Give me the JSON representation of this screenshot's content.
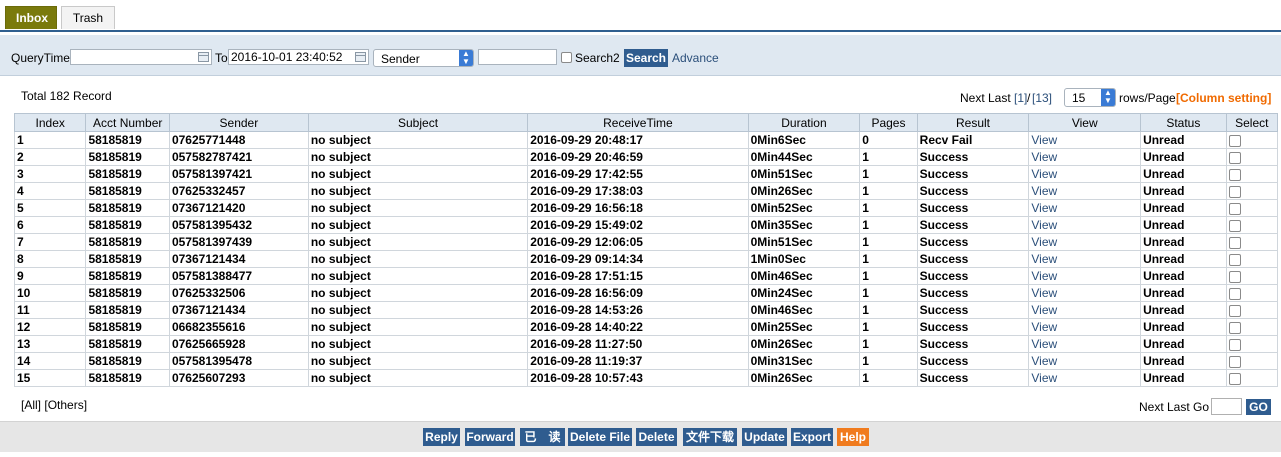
{
  "tabs": {
    "inbox": "Inbox",
    "trash": "Trash"
  },
  "query": {
    "query_time_label": "QueryTime",
    "from_value": "",
    "to_label": "To",
    "to_value": "2016-10-01 23:40:52",
    "field_select": "Sender",
    "keyword_value": "",
    "search2_label": "Search2",
    "search_button": "Search",
    "advance_link": "Advance"
  },
  "summary": {
    "total": "Total 182 Record",
    "pager_text": "Next Last",
    "page_current": "[1]",
    "page_sep": "/",
    "page_total": "[13]",
    "rows_per_page": "15",
    "rows_label": "rows/Page",
    "column_setting": "[Column setting]"
  },
  "table": {
    "columns": [
      "Index",
      "Acct Number",
      "Sender",
      "Subject",
      "ReceiveTime",
      "Duration",
      "Pages",
      "Result",
      "View",
      "Status",
      "Select"
    ],
    "rows": [
      [
        "1",
        "58185819",
        "07625771448",
        "no subject",
        "2016-09-29 20:48:17",
        "0Min6Sec",
        "0",
        "Recv Fail",
        "View",
        "Unread"
      ],
      [
        "2",
        "58185819",
        "057582787421",
        "no subject",
        "2016-09-29 20:46:59",
        "0Min44Sec",
        "1",
        "Success",
        "View",
        "Unread"
      ],
      [
        "3",
        "58185819",
        "057581397421",
        "no subject",
        "2016-09-29 17:42:55",
        "0Min51Sec",
        "1",
        "Success",
        "View",
        "Unread"
      ],
      [
        "4",
        "58185819",
        "07625332457",
        "no subject",
        "2016-09-29 17:38:03",
        "0Min26Sec",
        "1",
        "Success",
        "View",
        "Unread"
      ],
      [
        "5",
        "58185819",
        "07367121420",
        "no subject",
        "2016-09-29 16:56:18",
        "0Min52Sec",
        "1",
        "Success",
        "View",
        "Unread"
      ],
      [
        "6",
        "58185819",
        "057581395432",
        "no subject",
        "2016-09-29 15:49:02",
        "0Min35Sec",
        "1",
        "Success",
        "View",
        "Unread"
      ],
      [
        "7",
        "58185819",
        "057581397439",
        "no subject",
        "2016-09-29 12:06:05",
        "0Min51Sec",
        "1",
        "Success",
        "View",
        "Unread"
      ],
      [
        "8",
        "58185819",
        "07367121434",
        "no subject",
        "2016-09-29 09:14:34",
        "1Min0Sec",
        "1",
        "Success",
        "View",
        "Unread"
      ],
      [
        "9",
        "58185819",
        "057581388477",
        "no subject",
        "2016-09-28 17:51:15",
        "0Min46Sec",
        "1",
        "Success",
        "View",
        "Unread"
      ],
      [
        "10",
        "58185819",
        "07625332506",
        "no subject",
        "2016-09-28 16:56:09",
        "0Min24Sec",
        "1",
        "Success",
        "View",
        "Unread"
      ],
      [
        "11",
        "58185819",
        "07367121434",
        "no subject",
        "2016-09-28 14:53:26",
        "0Min46Sec",
        "1",
        "Success",
        "View",
        "Unread"
      ],
      [
        "12",
        "58185819",
        "06682355616",
        "no subject",
        "2016-09-28 14:40:22",
        "0Min25Sec",
        "1",
        "Success",
        "View",
        "Unread"
      ],
      [
        "13",
        "58185819",
        "07625665928",
        "no subject",
        "2016-09-28 11:27:50",
        "0Min26Sec",
        "1",
        "Success",
        "View",
        "Unread"
      ],
      [
        "14",
        "58185819",
        "057581395478",
        "no subject",
        "2016-09-28 11:19:37",
        "0Min31Sec",
        "1",
        "Success",
        "View",
        "Unread"
      ],
      [
        "15",
        "58185819",
        "07625607293",
        "no subject",
        "2016-09-28 10:57:43",
        "0Min26Sec",
        "1",
        "Success",
        "View",
        "Unread"
      ]
    ]
  },
  "footer": {
    "filter_all": "[All]",
    "filter_others": "[Others]",
    "pager_text": "Next Last Go",
    "go_value": "",
    "go_button": "GO"
  },
  "actions": {
    "reply": "Reply",
    "forward": "Forward",
    "mark_read": "已　读",
    "delete_file": "Delete File",
    "delete": "Delete",
    "download": "文件下载",
    "update": "Update",
    "export": "Export",
    "help": "Help"
  },
  "colors": {
    "accent": "#2f5c8f",
    "inbox_tab": "#7a7a0c",
    "help": "#f07b1e",
    "column_setting": "#f06a00"
  }
}
